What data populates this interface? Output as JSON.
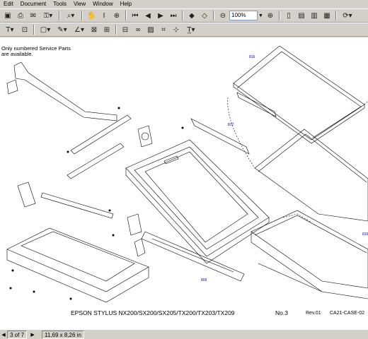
{
  "menu": [
    "Edit",
    "Document",
    "Tools",
    "View",
    "Window",
    "Help"
  ],
  "toolbar": {
    "zoom": "100%"
  },
  "document": {
    "note_line1": "Only numbered Service Parts",
    "note_line2": "are available.",
    "part_labels": {
      "p816": "816",
      "p817": "817",
      "p809": "809",
      "p815": "815"
    },
    "footer_title": "EPSON STYLUS NX200/SX200/SX205/TX200/TX203/TX209",
    "footer_no": "No.3",
    "footer_rev": "Rev.01",
    "footer_code": "CA21-CASE-02"
  },
  "status": {
    "page": "3 of 7",
    "size": "11,69 x 8,26 in"
  }
}
